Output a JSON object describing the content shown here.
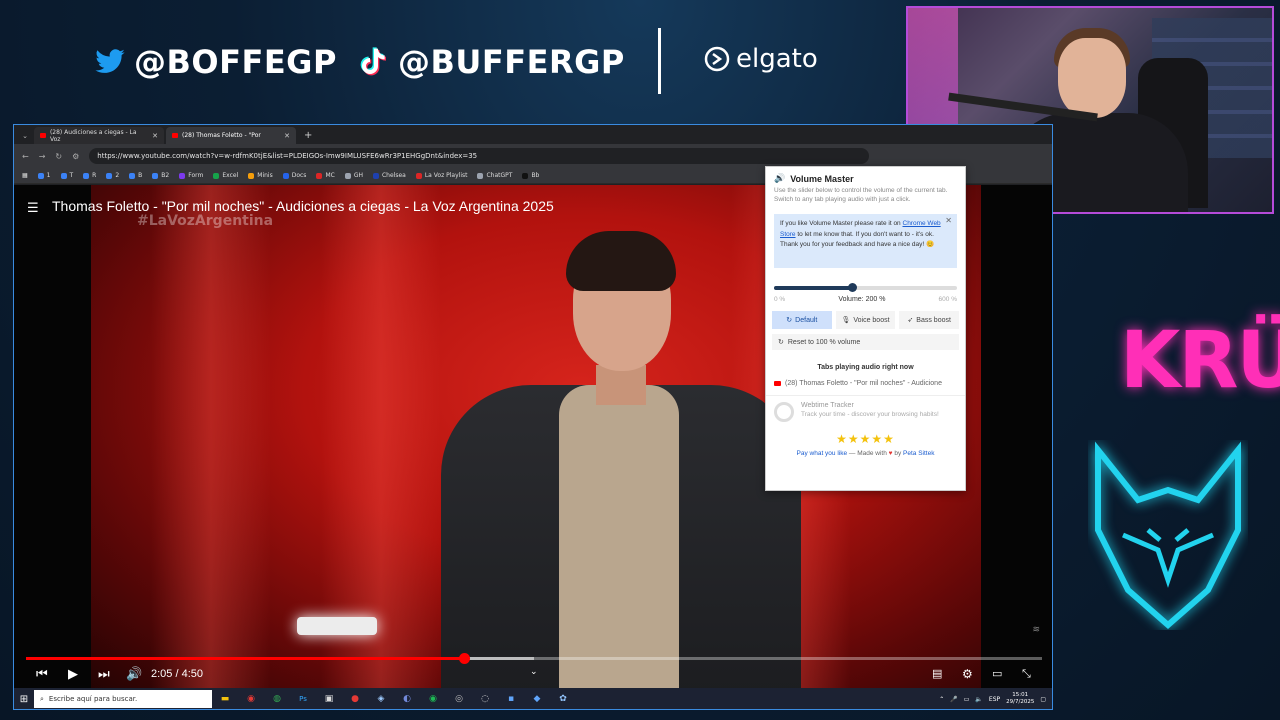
{
  "overlay": {
    "twitter_handle": "@BOFFEGP",
    "tiktok_handle": "@BUFFERGP",
    "sponsor": "elgato",
    "brand_text": "KRÜ",
    "colors": {
      "webcam_border": "#b54bd9",
      "brand_pink": "#ff2fb7",
      "fox_cyan": "#22d3ee"
    }
  },
  "browser": {
    "tabs": [
      {
        "label": "(28) Audiciones a ciegas - La Voz",
        "active": false
      },
      {
        "label": "(28) Thomas Foletto - \"Por",
        "active": true
      }
    ],
    "url": "https://www.youtube.com/watch?v=w-rdfmK0tjE&list=PLDEIGOs-Imw9IMLUSFE6wRr3P1EHGgDnt&index=35",
    "bookmarks": [
      "1",
      "T",
      "R",
      "2",
      "B",
      "B2",
      "Form",
      "Excel",
      "Minis",
      "Docs",
      "MC",
      "GH",
      "Chelsea",
      "La Voz Playlist",
      "ChatGPT",
      "Bb"
    ]
  },
  "video": {
    "title": "Thomas Foletto - \"Por mil noches\" - Audiciones a ciegas - La Voz Argentina 2025",
    "hashtag": "#LaVozArgentina",
    "time_display": "2:05 / 4:50",
    "progress_fraction": 0.431,
    "buffered_fraction": 0.5
  },
  "volume_master": {
    "title": "Volume Master",
    "description": "Use the slider below to control the volume of the current tab. Switch to any tab playing audio with just a click.",
    "notice_prefix": "If you like Volume Master please rate it on",
    "notice_link": "Chrome Web Store",
    "notice_suffix": "to let me know that. If you don't want to - it's ok. Thank you for your feedback and have a nice day! 😊",
    "slider_min": "0 %",
    "slider_max": "600 %",
    "volume_label": "Volume: 200 %",
    "volume_fraction": 0.4286,
    "modes": [
      "Default",
      "Voice boost",
      "Bass boost"
    ],
    "reset_label": "Reset to 100 % volume",
    "tabs_title": "Tabs playing audio right now",
    "audio_tab": "(28) Thomas Foletto - \"Por mil noches\" - Audicione",
    "ad_title": "Webtime Tracker",
    "ad_subtitle": "Track your time - discover your browsing habits!",
    "stars": "★★★★★",
    "footer_link_1": "Pay what you like",
    "footer_mid": "— Made with",
    "footer_heart": "♥",
    "footer_by": "by",
    "footer_link_2": "Peta Sittek"
  },
  "taskbar": {
    "search_placeholder": "Escribe aquí para buscar.",
    "language": "ESP",
    "time": "15:01",
    "date": "29/7/2025"
  }
}
